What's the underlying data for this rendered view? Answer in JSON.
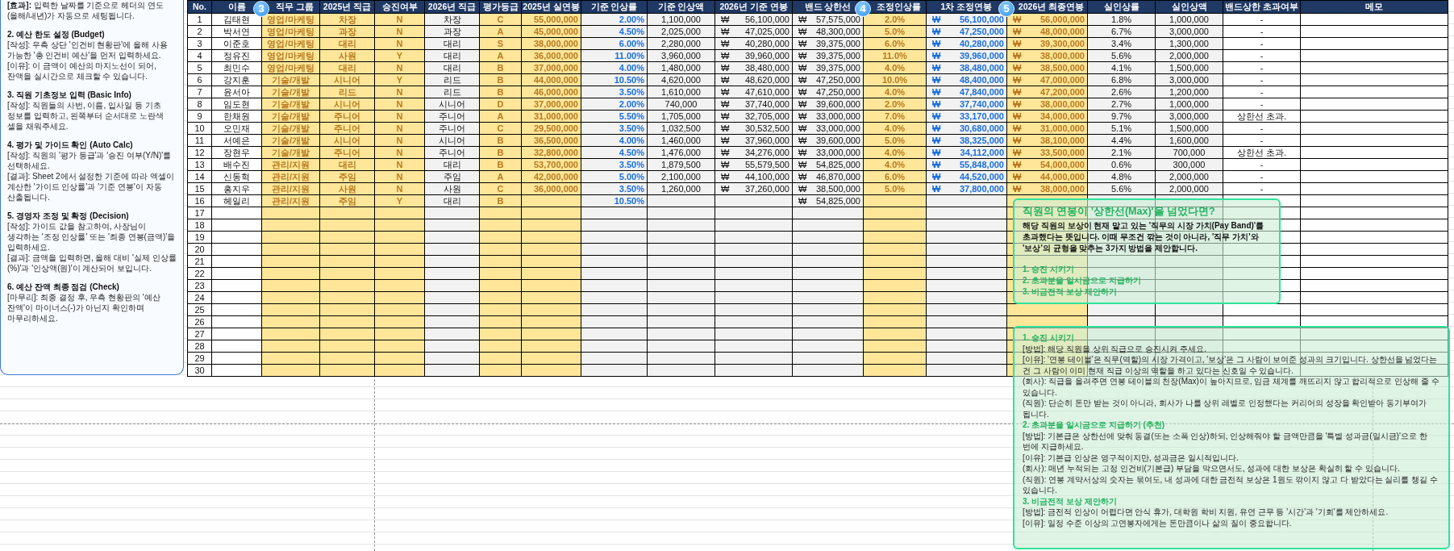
{
  "guide": {
    "sections": [
      {
        "lines": [
          "**[효과]:** 입력한 날짜를 기준으로 헤더의 연도(올해/내년)가 자동으로 세팅됩니다."
        ]
      },
      {
        "heading": "2. 예산 한도 설정 (Budget)",
        "lines": [
          "[작성]: 우측 상단 '인건비 현황판'에 올해 사용 가능한 '총 인건비 예산'을 먼저 입력하세요.",
          "[이유]: 이 금액이 예산의 마지노선이 되어, 잔액을 실시간으로 체크할 수 있습니다."
        ]
      },
      {
        "heading": "3. 직원 기초정보 입력 (Basic Info)",
        "lines": [
          "[작성]: 직원들의 사번, 이름, 입사일 등 기초 정보를 입력하고, 왼쪽부터 순서대로 노란색 셀을 채워주세요."
        ]
      },
      {
        "heading": "4. 평가 및 가이드 확인 (Auto Calc)",
        "lines": [
          "[작성]: 직원의 '평가 등급'과 '승진 여부(Y/N)'를 선택하세요.",
          "[결과]: Sheet 2에서 설정한 기준에 따라 엑셀이 계산한 '가이드 인상률'과 '기준 연봉'이 자동 산출됩니다."
        ]
      },
      {
        "heading": "5. 경영자 조정 및 확정 (Decision)",
        "lines": [
          "[작성]: 가이드 값을 참고하여, 사장님이 생각하는 '조정 인상률' 또는 '최종 연봉(금액)'을 입력하세요.",
          "[결과]: 금액을 입력하면, 올해 대비 '실제 인상률(%)'과 '인상액(원)'이 계산되어 보입니다."
        ]
      },
      {
        "heading": "6. 예산 잔액 최종 점검 (Check)",
        "lines": [
          "[마무리]: 최종 결정 후, 우측 현황판의 '예산 잔액'이 마이너스(-)가 아닌지 확인하며 마무리하세요."
        ]
      }
    ]
  },
  "table": {
    "columns": [
      {
        "label": "No.",
        "kind": "plain"
      },
      {
        "label": "이름",
        "kind": "plain"
      },
      {
        "label": "직무 그룹",
        "kind": "input",
        "badge": "3"
      },
      {
        "label": "2025년 직급",
        "kind": "input"
      },
      {
        "label": "승진여부",
        "kind": "input"
      },
      {
        "label": "2026년 직급",
        "kind": "calc"
      },
      {
        "label": "평가등급",
        "kind": "input"
      },
      {
        "label": "2025년 실연봉",
        "kind": "input"
      },
      {
        "label": "기준 인상률",
        "kind": "calc-blue"
      },
      {
        "label": "기준 인상액",
        "kind": "calc"
      },
      {
        "label": "2026년 기준 연봉",
        "kind": "calc"
      },
      {
        "label": "밴드 상한선",
        "kind": "calc"
      },
      {
        "label": "조정인상률",
        "kind": "input",
        "badge": "4"
      },
      {
        "label": "1차 조정연봉",
        "kind": "calc-blue"
      },
      {
        "label": "2026년 최종연봉",
        "kind": "input",
        "badge": "5"
      },
      {
        "label": "실인상률",
        "kind": "calc"
      },
      {
        "label": "실인상액",
        "kind": "calc"
      },
      {
        "label": "밴드상한 초과여부",
        "kind": "plain"
      },
      {
        "label": "메모",
        "kind": "plain"
      }
    ],
    "rows": [
      {
        "cells": [
          "1",
          "김태현",
          "영업/마케팅",
          "차장",
          "N",
          "차장",
          "C",
          "55,000,000",
          "2.00%",
          "1,100,000",
          {
            "symbol": "₩",
            "amount": "56,100,000"
          },
          {
            "symbol": "₩",
            "amount": "57,575,000"
          },
          "2.0%",
          {
            "symbol": "₩",
            "amount": "56,100,000"
          },
          {
            "symbol": "₩",
            "amount": "56,000,000"
          },
          "1.8%",
          "1,000,000",
          "-"
        ]
      },
      {
        "cells": [
          "2",
          "박서연",
          "영업/마케팅",
          "과장",
          "N",
          "과장",
          "A",
          "45,000,000",
          "4.50%",
          "2,025,000",
          {
            "symbol": "₩",
            "amount": "47,025,000"
          },
          {
            "symbol": "₩",
            "amount": "48,300,000"
          },
          "5.0%",
          {
            "symbol": "₩",
            "amount": "47,250,000"
          },
          {
            "symbol": "₩",
            "amount": "48,000,000"
          },
          "6.7%",
          "3,000,000",
          "-"
        ]
      },
      {
        "cells": [
          "3",
          "이준호",
          "영업/마케팅",
          "대리",
          "N",
          "대리",
          "S",
          "38,000,000",
          "6.00%",
          "2,280,000",
          {
            "symbol": "₩",
            "amount": "40,280,000"
          },
          {
            "symbol": "₩",
            "amount": "39,375,000"
          },
          "6.0%",
          {
            "symbol": "₩",
            "amount": "40,280,000"
          },
          {
            "symbol": "₩",
            "amount": "39,300,000"
          },
          "3.4%",
          "1,300,000",
          "-"
        ]
      },
      {
        "cells": [
          "4",
          "정유진",
          "영업/마케팅",
          "사원",
          "Y",
          "대리",
          "A",
          "36,000,000",
          "11.00%",
          "3,960,000",
          {
            "symbol": "₩",
            "amount": "39,960,000"
          },
          {
            "symbol": "₩",
            "amount": "39,375,000"
          },
          "11.0%",
          {
            "symbol": "₩",
            "amount": "39,960,000"
          },
          {
            "symbol": "₩",
            "amount": "38,000,000"
          },
          "5.6%",
          "2,000,000",
          "-"
        ]
      },
      {
        "cells": [
          "5",
          "최민수",
          "영업/마케팅",
          "대리",
          "N",
          "대리",
          "B",
          "37,000,000",
          "4.00%",
          "1,480,000",
          {
            "symbol": "₩",
            "amount": "38,480,000"
          },
          {
            "symbol": "₩",
            "amount": "39,375,000"
          },
          "4.0%",
          {
            "symbol": "₩",
            "amount": "38,480,000"
          },
          {
            "symbol": "₩",
            "amount": "38,500,000"
          },
          "4.1%",
          "1,500,000",
          "-"
        ]
      },
      {
        "cells": [
          "6",
          "강지훈",
          "기술/개발",
          "시니어",
          "Y",
          "리드",
          "B",
          "44,000,000",
          "10.50%",
          "4,620,000",
          {
            "symbol": "₩",
            "amount": "48,620,000"
          },
          {
            "symbol": "₩",
            "amount": "47,250,000"
          },
          "10.0%",
          {
            "symbol": "₩",
            "amount": "48,400,000"
          },
          {
            "symbol": "₩",
            "amount": "47,000,000"
          },
          "6.8%",
          "3,000,000",
          "-"
        ]
      },
      {
        "cells": [
          "7",
          "윤서아",
          "기술/개발",
          "리드",
          "N",
          "리드",
          "B",
          "46,000,000",
          "3.50%",
          "1,610,000",
          {
            "symbol": "₩",
            "amount": "47,610,000"
          },
          {
            "symbol": "₩",
            "amount": "47,250,000"
          },
          "4.0%",
          {
            "symbol": "₩",
            "amount": "47,840,000"
          },
          {
            "symbol": "₩",
            "amount": "47,200,000"
          },
          "2.6%",
          "1,200,000",
          "-"
        ]
      },
      {
        "cells": [
          "8",
          "임도현",
          "기술/개발",
          "시니어",
          "N",
          "시니어",
          "D",
          "37,000,000",
          "2.00%",
          "740,000",
          {
            "symbol": "₩",
            "amount": "37,740,000"
          },
          {
            "symbol": "₩",
            "amount": "39,600,000"
          },
          "2.0%",
          {
            "symbol": "₩",
            "amount": "37,740,000"
          },
          {
            "symbol": "₩",
            "amount": "38,000,000"
          },
          "2.7%",
          "1,000,000",
          "-"
        ]
      },
      {
        "cells": [
          "9",
          "한채원",
          "기술/개발",
          "주니어",
          "N",
          "주니어",
          "A",
          "31,000,000",
          "5.50%",
          "1,705,000",
          {
            "symbol": "₩",
            "amount": "32,705,000"
          },
          {
            "symbol": "₩",
            "amount": "33,000,000"
          },
          "7.0%",
          {
            "symbol": "₩",
            "amount": "33,170,000"
          },
          {
            "symbol": "₩",
            "amount": "34,000,000"
          },
          "9.7%",
          "3,000,000",
          "상한선 초과."
        ]
      },
      {
        "cells": [
          "10",
          "오민재",
          "기술/개발",
          "주니어",
          "N",
          "주니어",
          "C",
          "29,500,000",
          "3.50%",
          "1,032,500",
          {
            "symbol": "₩",
            "amount": "30,532,500"
          },
          {
            "symbol": "₩",
            "amount": "33,000,000"
          },
          "4.0%",
          {
            "symbol": "₩",
            "amount": "30,680,000"
          },
          {
            "symbol": "₩",
            "amount": "31,000,000"
          },
          "5.1%",
          "1,500,000",
          "-"
        ]
      },
      {
        "cells": [
          "11",
          "서예은",
          "기술/개발",
          "시니어",
          "N",
          "시니어",
          "B",
          "36,500,000",
          "4.00%",
          "1,460,000",
          {
            "symbol": "₩",
            "amount": "37,960,000"
          },
          {
            "symbol": "₩",
            "amount": "39,600,000"
          },
          "5.0%",
          {
            "symbol": "₩",
            "amount": "38,325,000"
          },
          {
            "symbol": "₩",
            "amount": "38,100,000"
          },
          "4.4%",
          "1,600,000",
          "-"
        ]
      },
      {
        "cells": [
          "12",
          "장현우",
          "기술/개발",
          "주니어",
          "N",
          "주니어",
          "B",
          "32,800,000",
          "4.50%",
          "1,476,000",
          {
            "symbol": "₩",
            "amount": "34,276,000"
          },
          {
            "symbol": "₩",
            "amount": "33,000,000"
          },
          "4.0%",
          {
            "symbol": "₩",
            "amount": "34,112,000"
          },
          {
            "symbol": "₩",
            "amount": "33,500,000"
          },
          "2.1%",
          "700,000",
          "상한선 초과."
        ]
      },
      {
        "cells": [
          "13",
          "배수진",
          "관리/지원",
          "대리",
          "N",
          "대리",
          "B",
          "53,700,000",
          "3.50%",
          "1,879,500",
          {
            "symbol": "₩",
            "amount": "55,579,500"
          },
          {
            "symbol": "₩",
            "amount": "54,825,000"
          },
          "4.0%",
          {
            "symbol": "₩",
            "amount": "55,848,000"
          },
          {
            "symbol": "₩",
            "amount": "54,000,000"
          },
          "0.6%",
          "300,000",
          "-"
        ]
      },
      {
        "cells": [
          "14",
          "신동혁",
          "관리/지원",
          "주임",
          "N",
          "주임",
          "A",
          "42,000,000",
          "5.00%",
          "2,100,000",
          {
            "symbol": "₩",
            "amount": "44,100,000"
          },
          {
            "symbol": "₩",
            "amount": "46,870,000"
          },
          "6.0%",
          {
            "symbol": "₩",
            "amount": "44,520,000"
          },
          {
            "symbol": "₩",
            "amount": "44,000,000"
          },
          "4.8%",
          "2,000,000",
          "-"
        ]
      },
      {
        "cells": [
          "15",
          "홍지우",
          "관리/지원",
          "사원",
          "N",
          "사원",
          "C",
          "36,000,000",
          "3.50%",
          "1,260,000",
          {
            "symbol": "₩",
            "amount": "37,260,000"
          },
          {
            "symbol": "₩",
            "amount": "38,500,000"
          },
          "5.0%",
          {
            "symbol": "₩",
            "amount": "37,800,000"
          },
          {
            "symbol": "₩",
            "amount": "38,000,000"
          },
          "5.6%",
          "2,000,000",
          "-"
        ]
      },
      {
        "cells": [
          "16",
          "헤일리",
          "관리/지원",
          "주임",
          "Y",
          "대리",
          "B",
          null,
          "10.50%",
          null,
          null,
          {
            "symbol": "₩",
            "amount": "54,825,000"
          }
        ]
      },
      {
        "cells": [
          "17"
        ]
      },
      {
        "cells": [
          "18"
        ]
      },
      {
        "cells": [
          "19"
        ]
      },
      {
        "cells": [
          "20"
        ]
      },
      {
        "cells": [
          "21"
        ]
      },
      {
        "cells": [
          "22"
        ]
      },
      {
        "cells": [
          "23"
        ]
      },
      {
        "cells": [
          "24"
        ]
      },
      {
        "cells": [
          "25"
        ]
      },
      {
        "cells": [
          "26"
        ]
      },
      {
        "cells": [
          "27"
        ]
      },
      {
        "cells": [
          "28"
        ]
      },
      {
        "cells": [
          "29"
        ]
      },
      {
        "cells": [
          "30"
        ]
      }
    ]
  },
  "callout": {
    "title": "직원의 연봉이 '상한선(Max)'을 넘었다면?",
    "body": "해당 직원의 보상이 현재 맡고 있는 '직무의 시장 가치(Pay Band)'를 초과했다는 뜻입니다. 이때 무조건 깎는 것이 아니라, '직무 가치'와 '보상'의 균형을 맞추는 3가지 방법을 제안합니다.",
    "options": [
      "1. 승진 시키기",
      "2. 초과분을 일시금으로 지급하기",
      "3. 비금전적 보상 제안하기"
    ]
  },
  "detail": {
    "sections": [
      {
        "heading": "1. 승진 시키기",
        "lines": [
          "[방법]: 해당 직원을 상위 직급으로 승진시켜 주세요.",
          "[이유]: '연봉 테이블'은 직무(역할)의 시장 가격이고, '보상'은 그 사람이 보여준 성과의 크기입니다. 상한선을 넘었다는 건 그 사람이 이미 현재 직급 이상의 역할을 하고 있다는 신호일 수 있습니다.",
          "(회사): 직급을 올려주면 연봉 테이블의 천장(Max)이 높아지므로, 임금 체계를 깨뜨리지 않고 합리적으로 인상해 줄 수 있습니다.",
          "(직원): 단순히 돈만 받는 것이 아니라, 회사가 나를 상위 레벨로 인정했다는 커리어의 성장을 확인받아 동기부여가 됩니다."
        ]
      },
      {
        "heading": "2. 초과분을 일시금으로 지급하기 (추천)",
        "lines": [
          "[방법]: 기본급은 상한선에 맞춰 동결(또는 소폭 인상)하되, 인상해줘야 할 금액만큼을 '특별 성과금(일시금)'으로 한 번에 지급하세요.",
          "[이유]: 기본급 인상은 영구적이지만, 성과금은 일시적입니다.",
          "(회사): 매년 누적되는 고정 인건비(기본급) 부담을 막으면서도, 성과에 대한 보상은 확실히 할 수 있습니다.",
          "(직원): 연봉 계약서상의 숫자는 묶여도, 내 성과에 대한 금전적 보상은 1원도 깎이지 않고 다 받았다는 실리를 챙길 수 있습니다."
        ]
      },
      {
        "heading": "3. 비금전적 보상 제안하기",
        "lines": [
          "[방법]: 금전적 인상이 어렵다면 안식 휴가, 대학원 학비 지원, 유연 근무 등 '시간'과 '기회'를 제안하세요.",
          "[이유]: 일정 수준 이상의 고연봉자에게는 돈만큼이나 삶의 질이 중요합니다."
        ]
      }
    ]
  }
}
